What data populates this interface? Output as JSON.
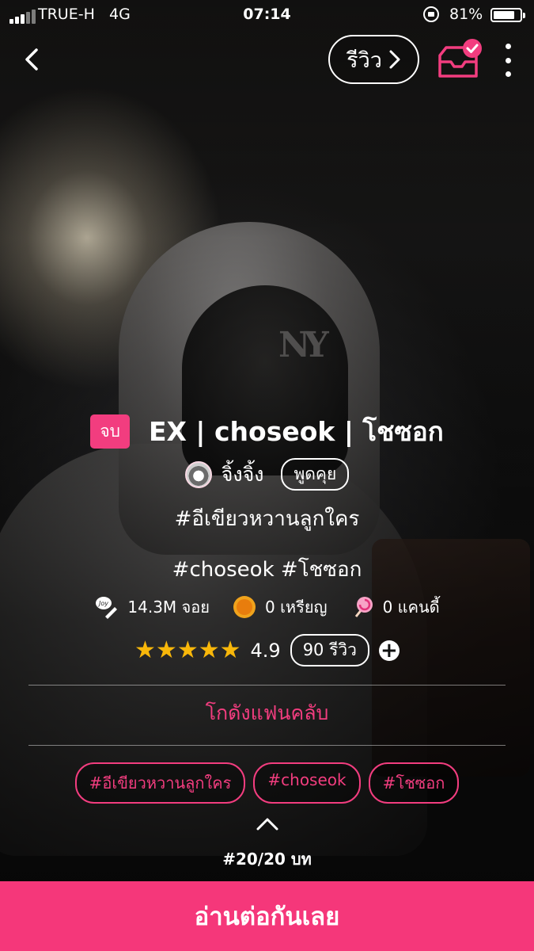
{
  "status_bar": {
    "carrier": "TRUE-H   4G",
    "time": "07:14",
    "battery": "81%",
    "battery_level": 0.81
  },
  "nav": {
    "review_label": "รีวิว",
    "back_icon": "chevron-left-icon",
    "inbox_icon": "inbox-check-icon",
    "more_icon": "more-vertical-icon"
  },
  "story": {
    "status_badge": "จบ",
    "title": "EX | choseok | โชซอก",
    "author": "จิ้งจิ้ง",
    "chat_label": "พูดคุย",
    "tagline1": "#อีเขียวหวานลูกใคร",
    "tagline2": "#choseok #โชซอก"
  },
  "stats": {
    "joy": "14.3M จอย",
    "coins": "0 เหรียญ",
    "candy": "0 แคนดี้"
  },
  "rating": {
    "stars": "★★★★★",
    "score": "4.9",
    "reviews": "90 รีวิว",
    "star_count": 5
  },
  "fanclub_label": "โกดังแฟนคลับ",
  "tags": [
    "#อีเขียวหวานลูกใคร",
    "#choseok",
    "#โชซอก"
  ],
  "chapter": "#20/20 บท",
  "read_button": "อ่านต่อกันเลย",
  "colors": {
    "accent": "#f5377a",
    "star": "#f8b70a"
  }
}
